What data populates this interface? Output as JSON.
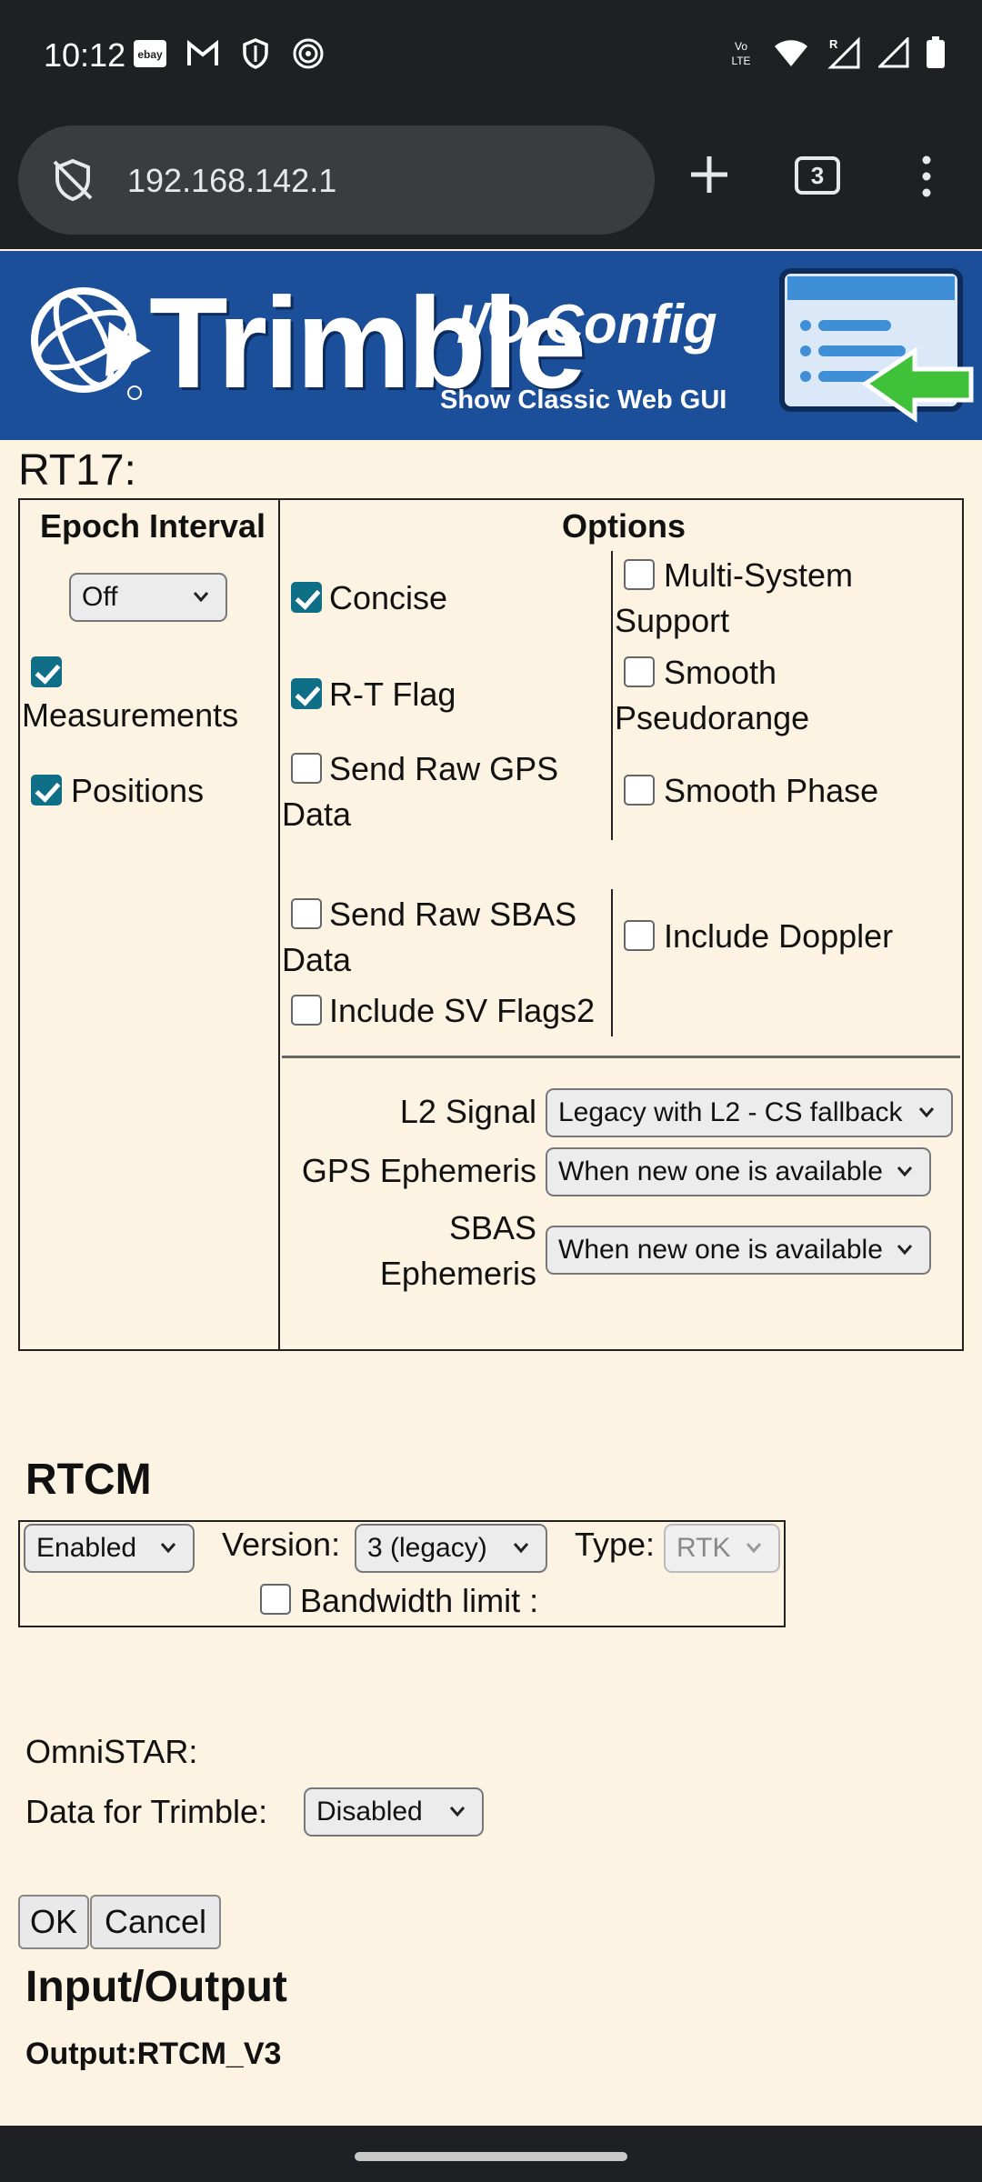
{
  "status_bar": {
    "time": "10:12",
    "left_icons": [
      "ebay-icon",
      "gmail-icon",
      "shield-icon",
      "fingerprint-icon"
    ],
    "left_icon_text": {
      "ebay": "ebay"
    },
    "right_icons": [
      "volte-icon",
      "wifi-icon",
      "signal-r-icon",
      "signal-icon",
      "battery-icon"
    ],
    "volte_text": "Vo LTE"
  },
  "browser": {
    "url": "192.168.142.1",
    "tab_count": "3"
  },
  "banner": {
    "brand": "Trimble",
    "config_title": "I/O Config",
    "classic_link": "Show Classic Web GUI"
  },
  "rt17": {
    "title": "RT17:",
    "epoch_header": "Epoch Interval",
    "options_header": "Options",
    "epoch_select": "Off",
    "measurements": {
      "label": "Measurements",
      "checked": true
    },
    "positions": {
      "label": "Positions",
      "checked": true
    },
    "options": [
      {
        "label": "Concise",
        "checked": true
      },
      {
        "label": "R-T Flag",
        "checked": true
      },
      {
        "label": "Send Raw GPS Data",
        "checked": false
      },
      {
        "label": "Multi-System Support",
        "checked": false
      },
      {
        "label": "Smooth Pseudorange",
        "checked": false
      },
      {
        "label": "Smooth Phase",
        "checked": false
      },
      {
        "label": "Send Raw SBAS Data",
        "checked": false
      },
      {
        "label": "Include SV Flags2",
        "checked": false
      },
      {
        "label": "Include Doppler",
        "checked": false
      }
    ],
    "l2_signal": {
      "label": "L2 Signal",
      "value": "Legacy with L2 - CS fallback"
    },
    "gps_ephemeris": {
      "label": "GPS Ephemeris",
      "value": "When new one is available"
    },
    "sbas_ephemeris": {
      "label1": "SBAS",
      "label2": "Ephemeris",
      "value": "When new one is available"
    }
  },
  "rtcm": {
    "title": "RTCM",
    "enabled_select": "Enabled",
    "version_label": "Version:",
    "version_select": "3 (legacy)",
    "type_label": "Type:",
    "type_select": "RTK",
    "bandwidth_label": "Bandwidth limit :"
  },
  "omnistar": {
    "title": "OmniSTAR:",
    "data_label": "Data for Trimble:",
    "data_select": "Disabled"
  },
  "buttons": {
    "ok": "OK",
    "cancel": "Cancel"
  },
  "input_output": {
    "title": "Input/Output",
    "output": "Output:RTCM_V3"
  },
  "colors": {
    "banner_blue": "#1c4f9a",
    "page_bg": "#fdf3e2",
    "checkbox_on": "#0e6f86",
    "chrome_dark": "#1f2023"
  }
}
